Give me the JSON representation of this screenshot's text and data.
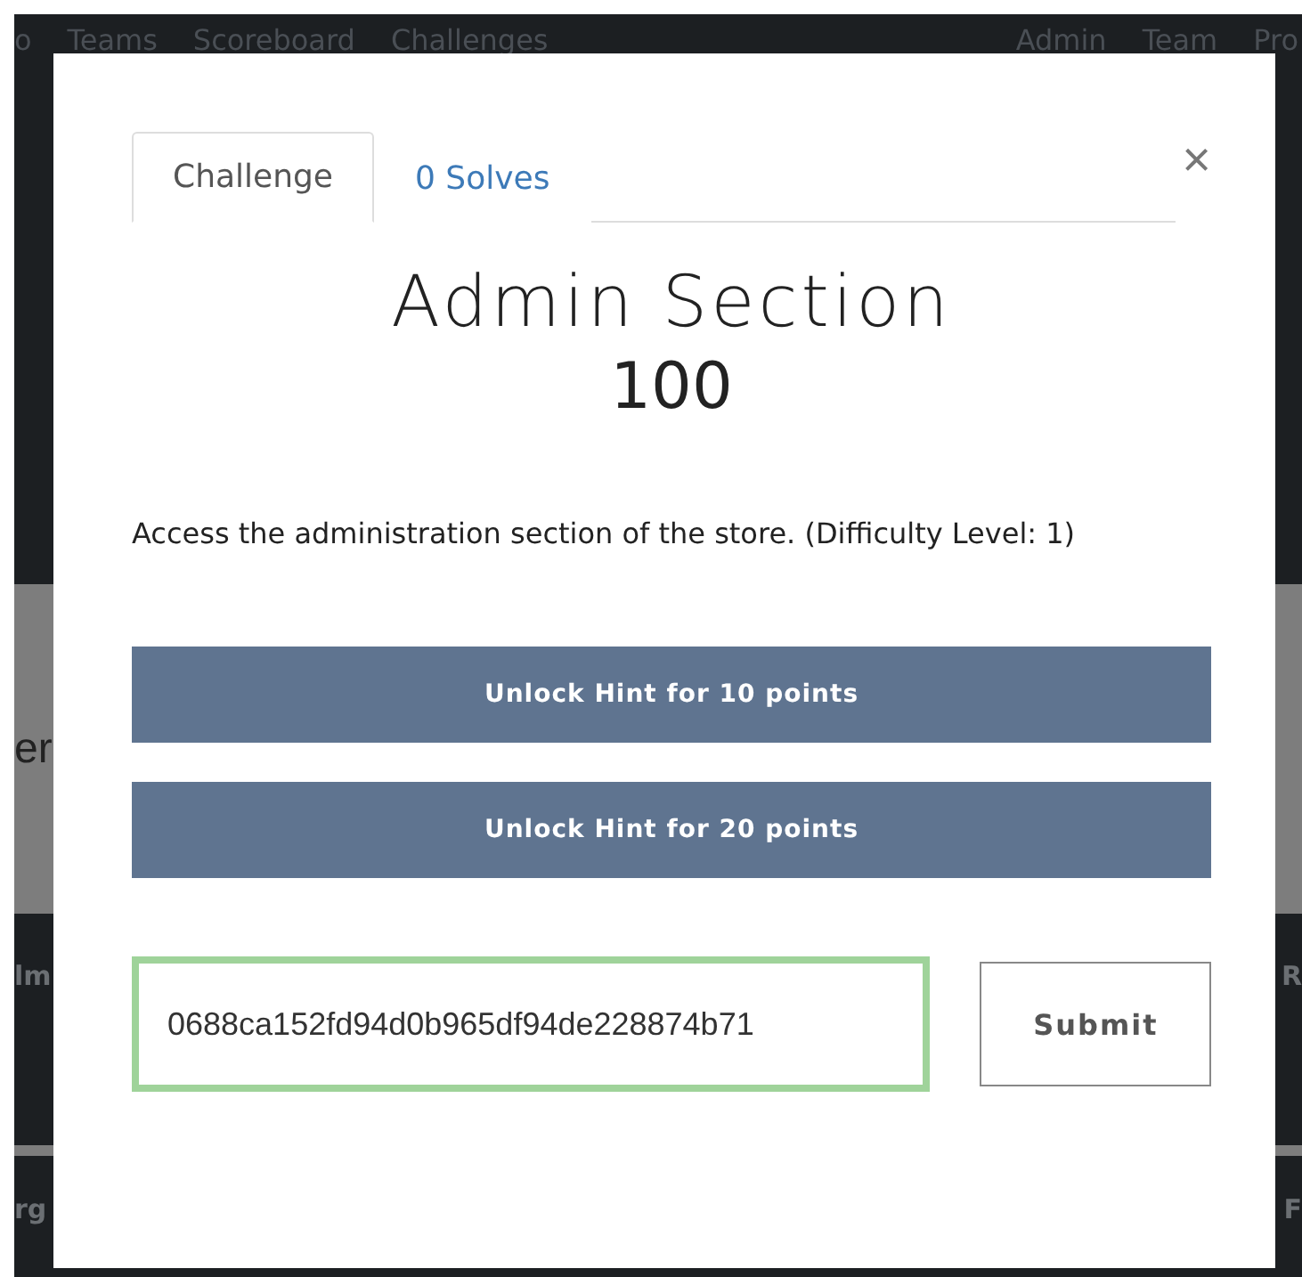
{
  "navbar": {
    "left_items": [
      "o",
      "Teams",
      "Scoreboard",
      "Challenges"
    ],
    "right_items": [
      "Admin",
      "Team",
      "Pro"
    ]
  },
  "background_fragments": {
    "heading": "er",
    "row_1_left": "lm",
    "row_1_right": "R",
    "row_2_left": "rg",
    "row_2_right": "F"
  },
  "modal": {
    "close": "×",
    "tabs": [
      {
        "label": "Challenge",
        "selected": true
      },
      {
        "label": "0 Solves",
        "selected": false
      }
    ],
    "title": "Admin Section",
    "points": "100",
    "description": "Access the administration section of the store. (Difficulty Level: 1)",
    "hints": [
      "Unlock Hint for 10 points",
      "Unlock Hint for 20 points"
    ],
    "flag_field": {
      "value": "0688ca152fd94d0b965df94de228874b71",
      "focused": true
    },
    "submit": "Submit"
  }
}
